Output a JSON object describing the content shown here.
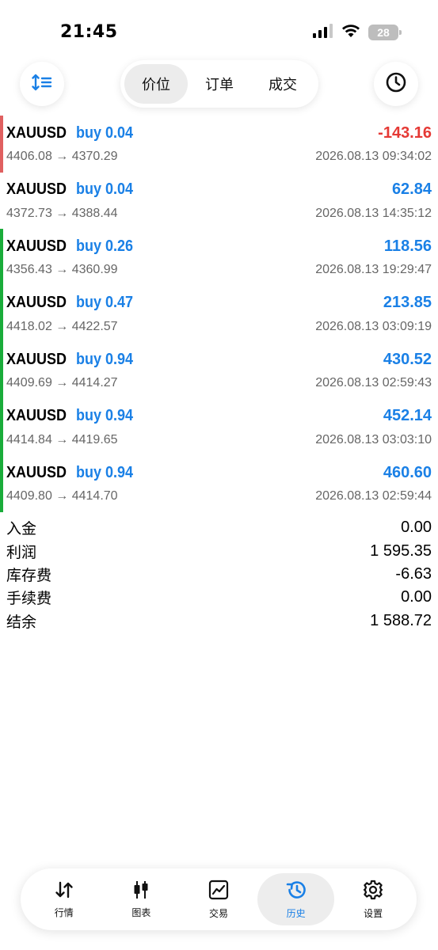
{
  "status_bar": {
    "time": "21:45",
    "battery": "28"
  },
  "header": {
    "segments": [
      {
        "label": "价位",
        "active": true
      },
      {
        "label": "订单",
        "active": false
      },
      {
        "label": "成交",
        "active": false
      }
    ]
  },
  "colors": {
    "accent": "#1a80e6",
    "loss": "#e53935",
    "profit_bar": "#1aac3a",
    "loss_bar": "#e06060"
  },
  "positions": [
    {
      "symbol": "XAUUSD",
      "side": "buy 0.04",
      "profit": "-143.16",
      "prices": "4406.08 → 4370.29",
      "time": "2026.08.13 09:34:02",
      "status": "loss"
    },
    {
      "symbol": "XAUUSD",
      "side": "buy 0.04",
      "profit": "62.84",
      "prices": "4372.73 → 4388.44",
      "time": "2026.08.13 14:35:12",
      "status": "none"
    },
    {
      "symbol": "XAUUSD",
      "side": "buy 0.26",
      "profit": "118.56",
      "prices": "4356.43 → 4360.99",
      "time": "2026.08.13 19:29:47",
      "status": "profit"
    },
    {
      "symbol": "XAUUSD",
      "side": "buy 0.47",
      "profit": "213.85",
      "prices": "4418.02 → 4422.57",
      "time": "2026.08.13 03:09:19",
      "status": "profit"
    },
    {
      "symbol": "XAUUSD",
      "side": "buy 0.94",
      "profit": "430.52",
      "prices": "4409.69 → 4414.27",
      "time": "2026.08.13 02:59:43",
      "status": "profit"
    },
    {
      "symbol": "XAUUSD",
      "side": "buy 0.94",
      "profit": "452.14",
      "prices": "4414.84 → 4419.65",
      "time": "2026.08.13 03:03:10",
      "status": "profit"
    },
    {
      "symbol": "XAUUSD",
      "side": "buy 0.94",
      "profit": "460.60",
      "prices": "4409.80 → 4414.70",
      "time": "2026.08.13 02:59:44",
      "status": "profit"
    }
  ],
  "summary": [
    {
      "label": "入金",
      "value": "0.00"
    },
    {
      "label": "利润",
      "value": "1 595.35"
    },
    {
      "label": "库存费",
      "value": "-6.63"
    },
    {
      "label": "手续费",
      "value": "0.00"
    },
    {
      "label": "结余",
      "value": "1 588.72"
    }
  ],
  "tabbar": {
    "tabs": [
      {
        "label": "行情",
        "icon": "quotes-arrows-icon",
        "active": false
      },
      {
        "label": "图表",
        "icon": "candlestick-chart-icon",
        "active": false
      },
      {
        "label": "交易",
        "icon": "trade-chart-icon",
        "active": false
      },
      {
        "label": "历史",
        "icon": "history-clock-icon",
        "active": true
      },
      {
        "label": "设置",
        "icon": "gear-icon",
        "active": false
      }
    ]
  }
}
